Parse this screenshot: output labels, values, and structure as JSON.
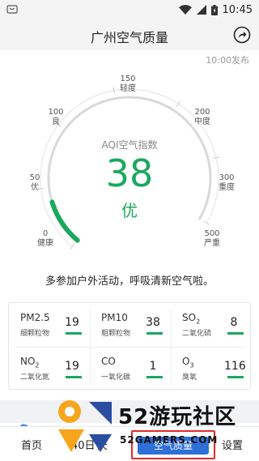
{
  "status": {
    "time": "10:45"
  },
  "header": {
    "title": "广州空气质量"
  },
  "publish_time": "10:00发布",
  "gauge": {
    "label": "AQI空气指数",
    "value": "38",
    "level": "优",
    "aqi": 38,
    "max": 500,
    "ticks": [
      {
        "value": "0",
        "level": "健康"
      },
      {
        "value": "50",
        "level": "优"
      },
      {
        "value": "100",
        "level": "良"
      },
      {
        "value": "150",
        "level": "轻度"
      },
      {
        "value": "200",
        "level": "中度"
      },
      {
        "value": "300",
        "level": "重度"
      },
      {
        "value": "500",
        "level": "严重"
      }
    ],
    "accent_color": "#1aa85f",
    "track_color": "#d9d9d9"
  },
  "advice": "多参加户外活动，呼吸清新空气啦。",
  "pollutants": [
    {
      "name": "PM2.5",
      "sub": "",
      "desc": "细颗粒物",
      "value": "19"
    },
    {
      "name": "PM10",
      "sub": "",
      "desc": "粗颗粒物",
      "value": "38"
    },
    {
      "name": "SO",
      "sub": "2",
      "desc": "二氧化硫",
      "value": "8"
    },
    {
      "name": "NO",
      "sub": "2",
      "desc": "二氧化氮",
      "value": "19"
    },
    {
      "name": "CO",
      "sub": "",
      "desc": "一氧化碳",
      "value": "1"
    },
    {
      "name": "O",
      "sub": "3",
      "desc": "臭氧",
      "value": "116"
    }
  ],
  "bottom_strip_text": "基本",
  "nav": {
    "home": "首页",
    "days40": "40日",
    "tian": "天",
    "settings": "设置",
    "active": "空气质量"
  },
  "watermark": {
    "text": "52游玩社区",
    "sub": "52GAMERS.COM"
  }
}
